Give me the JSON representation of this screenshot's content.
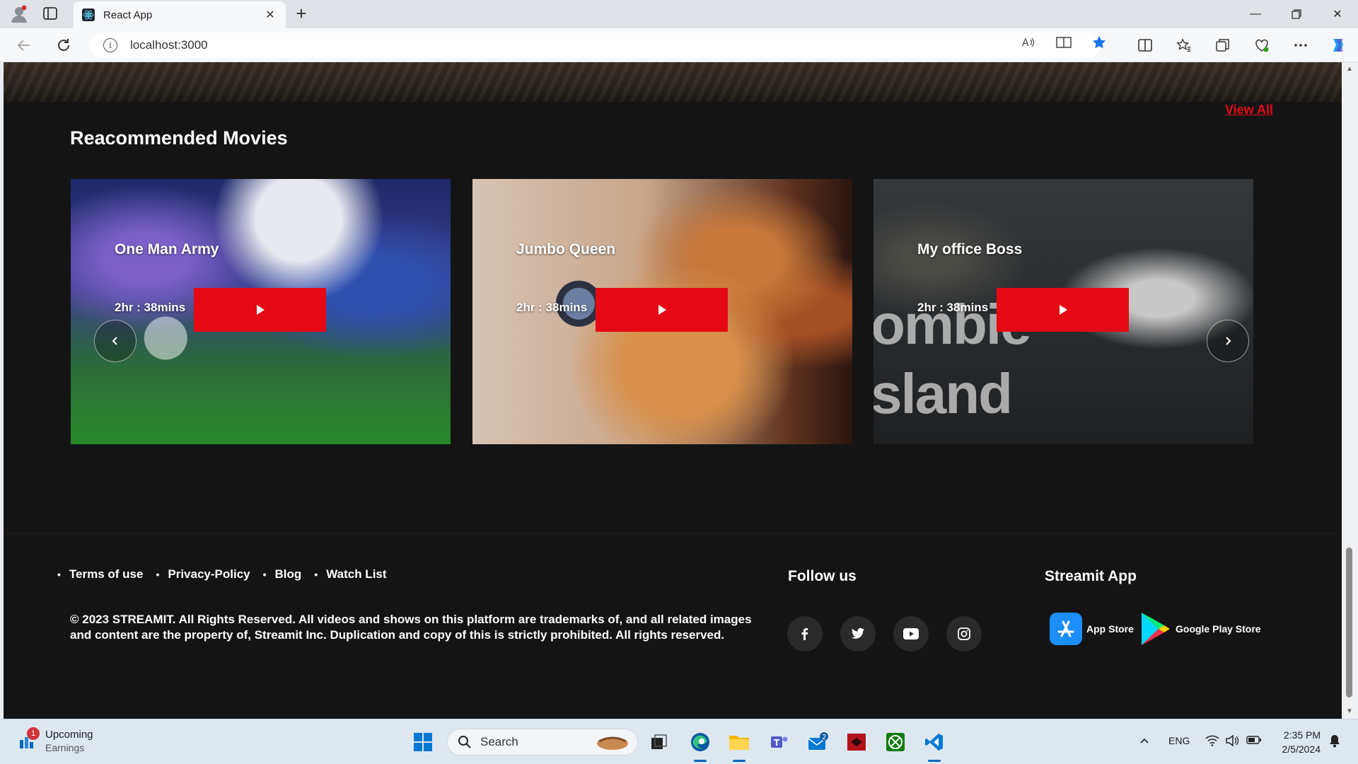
{
  "browser": {
    "tab_title": "React App",
    "url": "localhost:3000"
  },
  "page": {
    "view_all": "View All",
    "section_title": "Reacommended Movies",
    "movies": [
      {
        "title": "One Man Army",
        "duration": "2hr : 38mins"
      },
      {
        "title": "Jumbo Queen",
        "duration": "2hr : 38mins"
      },
      {
        "title": "My office Boss",
        "duration": "2hr : 38mins",
        "poster_text": [
          "ombie",
          "sland"
        ]
      }
    ],
    "footer": {
      "links": [
        "Terms of use",
        "Privacy-Policy",
        "Blog",
        "Watch List"
      ],
      "copyright": "© 2023 STREAMIT. All Rights Reserved. All videos and shows on this platform are trademarks of, and all related images and content are the property of, Streamit Inc. Duplication and copy of this is strictly prohibited. All rights reserved.",
      "follow_title": "Follow us",
      "social": [
        "facebook-icon",
        "twitter-icon",
        "youtube-icon",
        "instagram-icon"
      ],
      "app_title": "Streamit App",
      "app_store": "App Store",
      "play_store": "Google Play Store"
    },
    "colors": {
      "accent": "#e50914",
      "background": "#141414"
    }
  },
  "taskbar": {
    "weather_title": "Upcoming",
    "weather_sub": "Earnings",
    "weather_badge": "1",
    "search_label": "Search",
    "mail_badge": "2",
    "lang": "ENG",
    "time": "2:35 PM",
    "date": "2/5/2024"
  }
}
